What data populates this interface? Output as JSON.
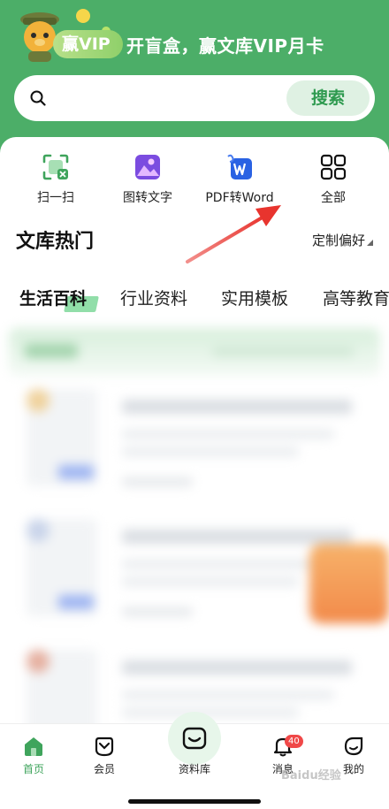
{
  "header": {
    "vip_badge": "赢VIP",
    "promo_text": "开盲盒，赢文库VIP月卡"
  },
  "search": {
    "placeholder": "",
    "button_label": "搜索"
  },
  "tools": [
    {
      "label": "扫一扫",
      "icon": "scan-icon"
    },
    {
      "label": "图转文字",
      "icon": "image-to-text-icon"
    },
    {
      "label": "PDF转Word",
      "icon": "pdf-to-word-icon"
    },
    {
      "label": "全部",
      "icon": "grid-icon"
    }
  ],
  "section": {
    "title": "文库热门",
    "preference_label": "定制偏好"
  },
  "tabs": [
    {
      "label": "生活百科",
      "active": true
    },
    {
      "label": "行业资料",
      "active": false
    },
    {
      "label": "实用模板",
      "active": false
    },
    {
      "label": "高等教育",
      "active": false
    }
  ],
  "bottom_nav": {
    "items": [
      {
        "label": "首页",
        "icon": "home-icon",
        "active": true
      },
      {
        "label": "会员",
        "icon": "member-icon",
        "active": false
      },
      {
        "label": "资料库",
        "icon": "library-icon",
        "active": false
      },
      {
        "label": "消息",
        "icon": "bell-icon",
        "active": false,
        "badge": "40"
      },
      {
        "label": "我的",
        "icon": "profile-icon",
        "active": false
      }
    ]
  },
  "watermark": "Baidu经验",
  "colors": {
    "brand_green": "#4cae68",
    "accent_green": "#2e9a4f",
    "badge_red": "#f04848",
    "arrow_red": "#e8342e"
  }
}
